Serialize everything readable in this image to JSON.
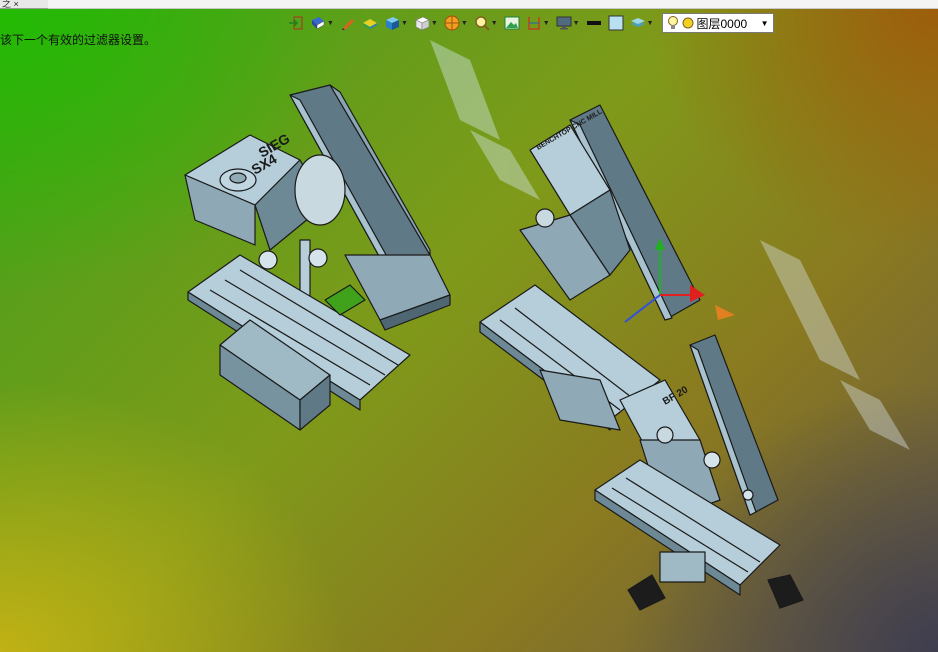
{
  "window": {
    "tab_label": "之 ×"
  },
  "viewport": {
    "status_message": "该下一个有效的过滤器设置。",
    "model_labels": [
      "SIEG",
      "SX4",
      "BENCHTOP CNC MILL",
      "BF 20"
    ]
  },
  "toolbar": {
    "buttons": [
      {
        "name": "exit-sketch-icon",
        "dropdown": false
      },
      {
        "name": "view-orient-icon",
        "dropdown": true
      },
      {
        "name": "pencil-icon",
        "dropdown": false
      },
      {
        "name": "surface-icon",
        "dropdown": false
      },
      {
        "name": "solid-cube-icon",
        "dropdown": true
      },
      {
        "name": "white-cube-icon",
        "dropdown": true
      },
      {
        "name": "section-view-icon",
        "dropdown": true
      },
      {
        "name": "zoom-icon",
        "dropdown": true
      },
      {
        "name": "image-icon",
        "dropdown": false
      },
      {
        "name": "measure-icon",
        "dropdown": true
      },
      {
        "name": "monitor-icon",
        "dropdown": true
      },
      {
        "name": "line-color-icon",
        "dropdown": false
      },
      {
        "name": "fill-color-icon",
        "dropdown": false
      },
      {
        "name": "layer-stack-icon",
        "dropdown": true
      }
    ],
    "layer": {
      "value": "图层0000"
    }
  },
  "colors": {
    "accent_red": "#e02020",
    "axis_green": "#20b020",
    "axis_blue": "#3050e0"
  }
}
